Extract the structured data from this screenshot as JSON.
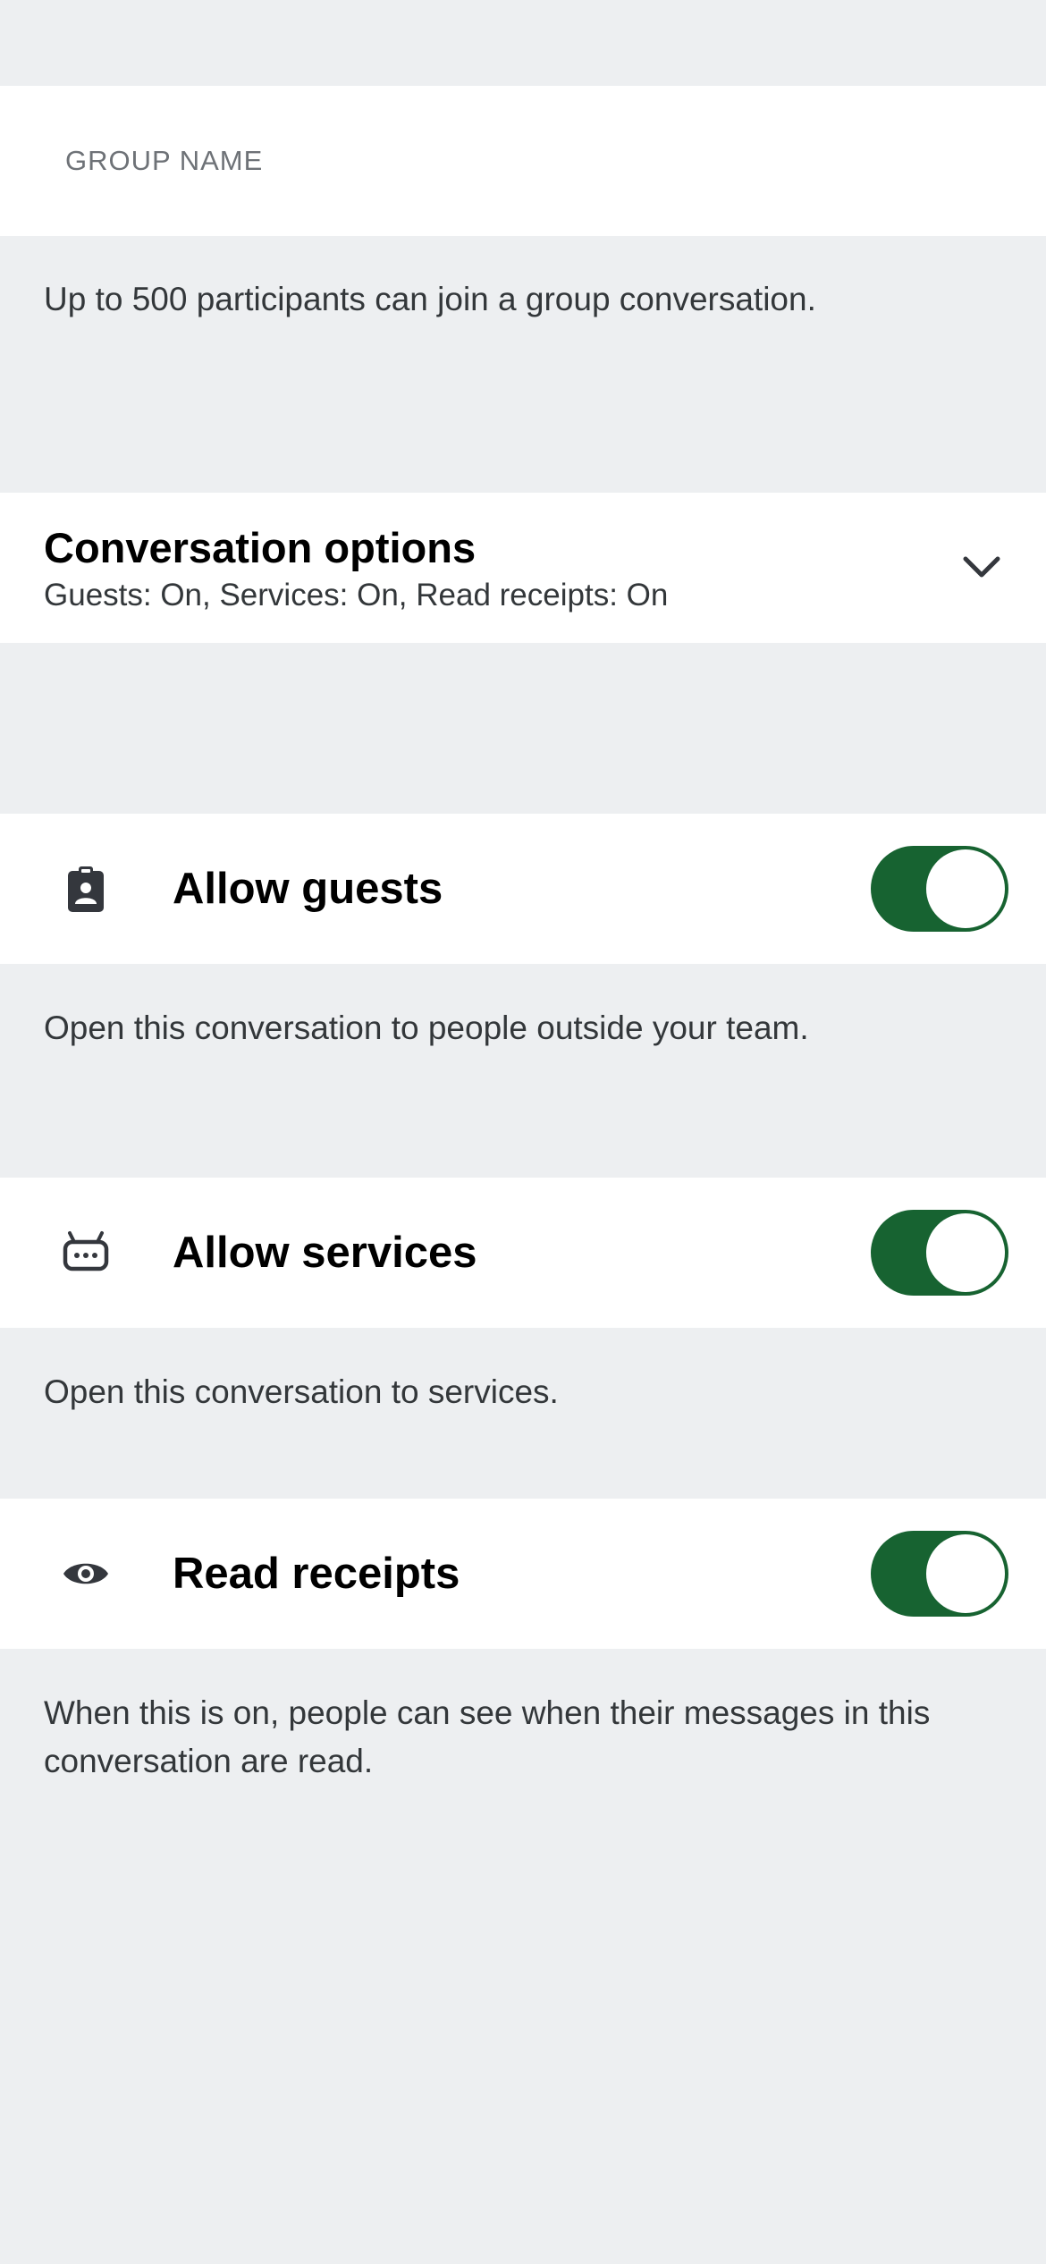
{
  "group_name": {
    "placeholder": "GROUP NAME",
    "value": ""
  },
  "participants_note": "Up to 500 participants can join a group conversation.",
  "conversation_options": {
    "title": "Conversation options",
    "summary": "Guests: On, Services: On, Read receipts: On",
    "icon": "chevron-down-icon",
    "expanded": true
  },
  "settings": [
    {
      "label": "Allow guests",
      "icon": "guest-badge-icon",
      "enabled": true,
      "description": "Open this conversation to people outside your team."
    },
    {
      "label": "Allow services",
      "icon": "service-bot-icon",
      "enabled": true,
      "description": "Open this conversation to services."
    },
    {
      "label": "Read receipts",
      "icon": "eye-icon",
      "enabled": true,
      "description": "When this is on, people can see when their messages in this conversation are read."
    }
  ],
  "colors": {
    "background": "#edeff1",
    "row": "#ffffff",
    "toggle_on": "#176331",
    "secondary_text": "#33373a",
    "placeholder_text": "#6e7277",
    "icon": "#34373d"
  }
}
